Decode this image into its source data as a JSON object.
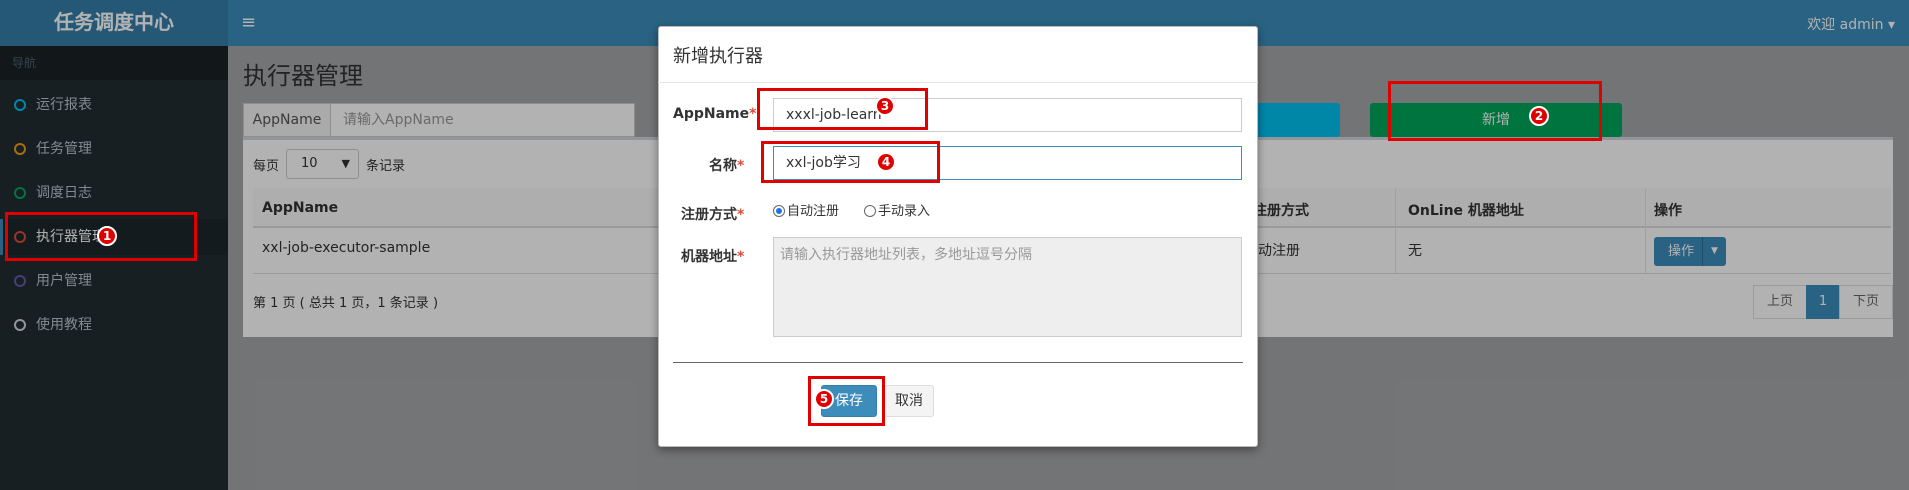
{
  "header": {
    "logo": "任务调度中心",
    "menu_icon": "hamburger-icon",
    "user": "欢迎 admin",
    "user_caret": "▾"
  },
  "sidebar": {
    "section": "导航",
    "items": [
      {
        "label": "运行报表",
        "color": "#00c0ef"
      },
      {
        "label": "任务管理",
        "color": "#f39c12"
      },
      {
        "label": "调度日志",
        "color": "#00a65a"
      },
      {
        "label": "执行器管理",
        "color": "#dd4b39"
      },
      {
        "label": "用户管理",
        "color": "#605ca8"
      },
      {
        "label": "使用教程",
        "color": "#d2d6de"
      }
    ]
  },
  "main": {
    "title": "执行器管理",
    "search": {
      "addon": "AppName",
      "placeholder": "请输入AppName"
    },
    "add_label": "新增",
    "per_page": {
      "prefix": "每页",
      "value": "10",
      "suffix": "条记录"
    },
    "table": {
      "headers": [
        "AppName",
        "注册方式",
        "OnLine 机器地址",
        "操作"
      ],
      "rows": [
        {
          "appname": "xxl-job-executor-sample",
          "reg": "动注册",
          "online": "无",
          "op": "操作"
        }
      ]
    },
    "page_info": "第 1 页 ( 总共 1 页，1 条记录 )",
    "pager": {
      "prev": "上页",
      "current": "1",
      "next": "下页"
    }
  },
  "modal": {
    "title": "新增执行器",
    "appname_label": "AppName",
    "appname_value": "xxxl-job-learn",
    "name_label": "名称",
    "name_value": "xxl-job学习",
    "reg_label": "注册方式",
    "reg_options": [
      "自动注册",
      "手动录入"
    ],
    "reg_selected": "自动注册",
    "addr_label": "机器地址",
    "addr_placeholder": "请输入执行器地址列表，多地址逗号分隔",
    "required_mark": "*",
    "save": "保存",
    "cancel": "取消"
  },
  "annotations": {
    "color": "#e00000",
    "markers": [
      "1",
      "2",
      "3",
      "4",
      "5"
    ]
  }
}
